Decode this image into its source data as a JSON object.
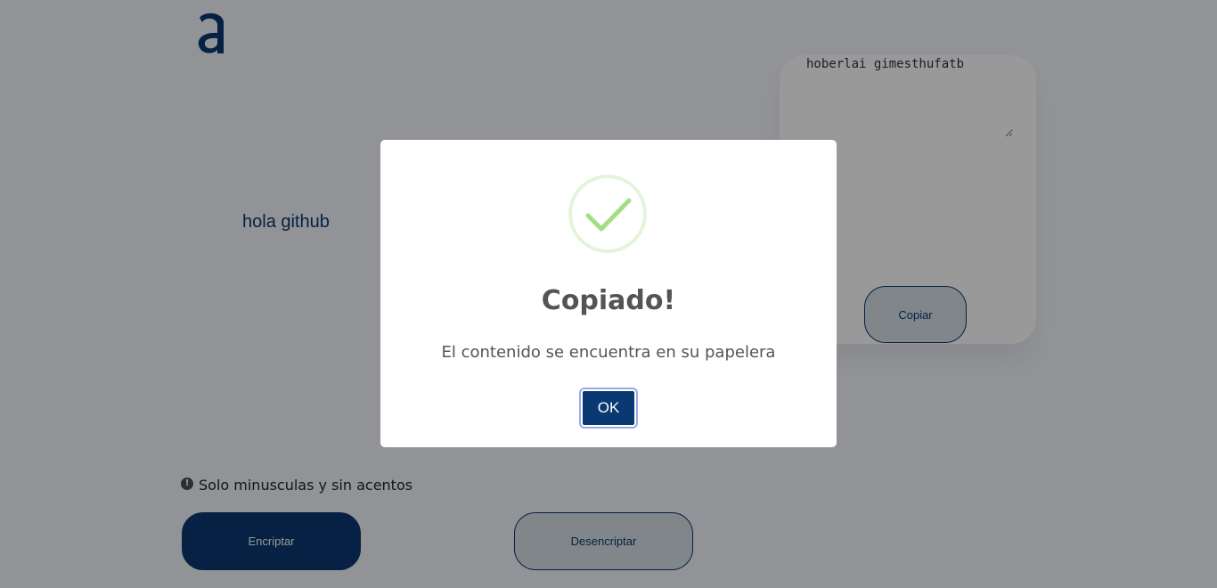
{
  "app": {
    "logo_icon": "alura-a-logo-icon"
  },
  "input": {
    "value": "hola github"
  },
  "output": {
    "value": "hoberlai gimesthufatb",
    "copy_label": "Copiar"
  },
  "warning": {
    "icon": "exclamation-circle-icon",
    "text": "Solo minusculas y sin acentos"
  },
  "actions": {
    "encrypt_label": "Encriptar",
    "decrypt_label": "Desencriptar"
  },
  "modal": {
    "icon": "success-check-icon",
    "title": "Copiado!",
    "text": "El contenido se encuentra en su papelera",
    "ok_label": "OK"
  },
  "colors": {
    "primary": "#0a3871",
    "page_background": "#f3f5fc",
    "secondary_button": "#d8dfe8",
    "success": "#a5dc86"
  }
}
